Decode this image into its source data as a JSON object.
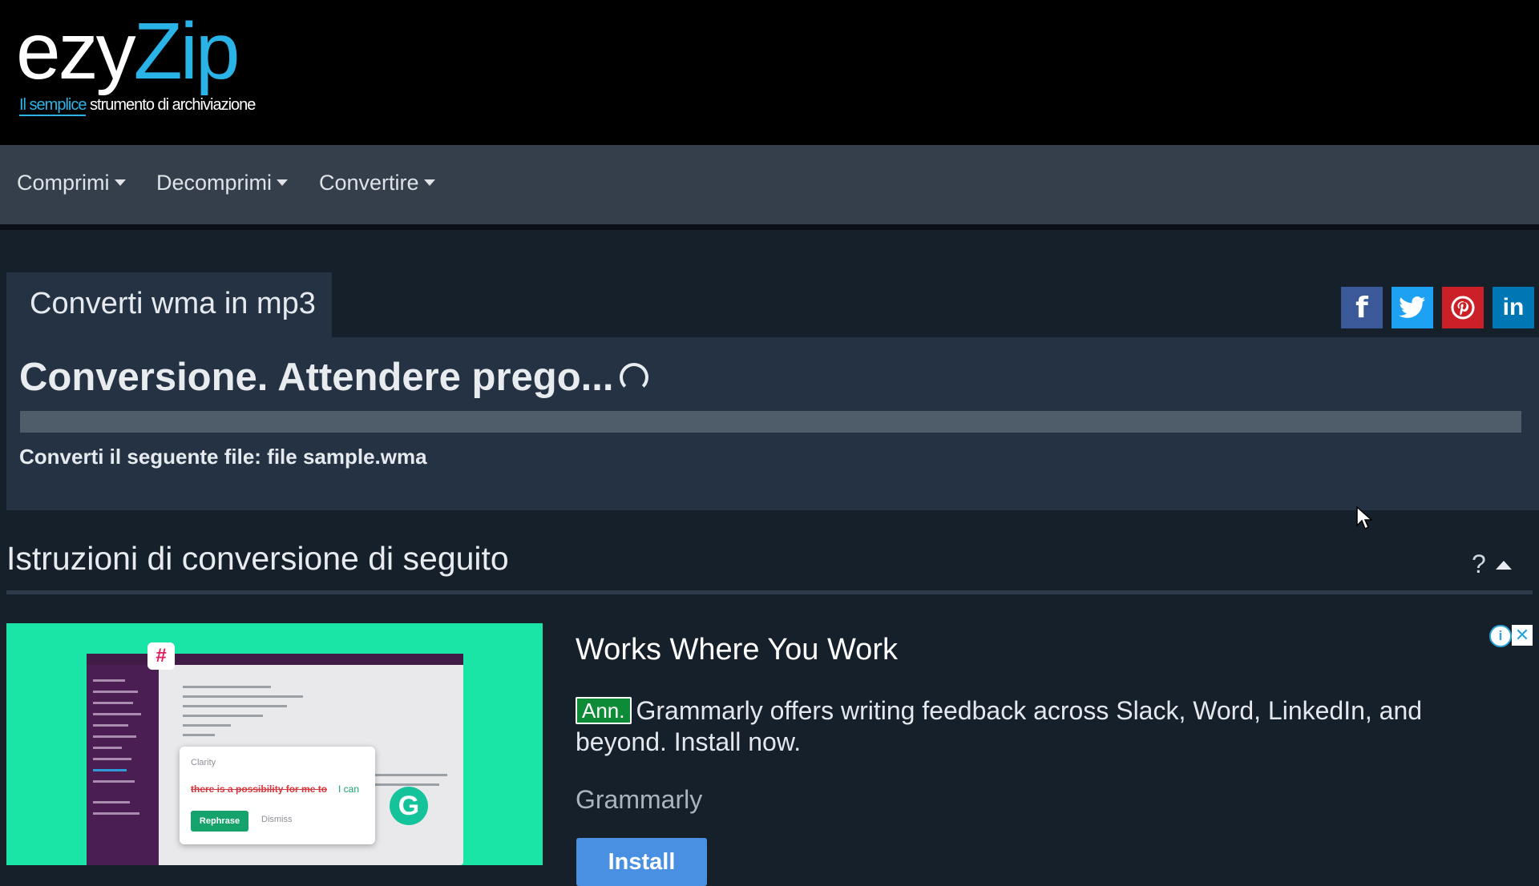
{
  "logo": {
    "brand_part1": "ezy",
    "brand_part2": "Zip",
    "tagline_highlight": "Il semplice",
    "tagline_rest": " strumento di archiviazione"
  },
  "nav": {
    "items": [
      {
        "label": "Comprimi"
      },
      {
        "label": "Decomprimi"
      },
      {
        "label": "Convertire"
      }
    ]
  },
  "converter": {
    "tab_title": "Converti wma in mp3",
    "status": "Conversione. Attendere prego...",
    "progress_fraction": 0,
    "file_line": "Converti il seguente file: file sample.wma"
  },
  "social": {
    "facebook_glyph": "f",
    "linkedin_glyph": "in",
    "icons": [
      "facebook-icon",
      "twitter-icon",
      "pinterest-icon",
      "linkedin-icon"
    ]
  },
  "instructions": {
    "heading": "Istruzioni di conversione di seguito",
    "help": "?"
  },
  "ad": {
    "headline": "Works Where You Work",
    "badge": "Ann.",
    "body": "Grammarly offers writing feedback across Slack, Word, LinkedIn, and beyond. Install now.",
    "advertiser": "Grammarly",
    "install_label": "Install",
    "info_glyph": "i",
    "close_glyph": "✕",
    "image": {
      "clarity_label": "Clarity",
      "strike_text": "there is a possibility for me to",
      "replacement_text": "I can",
      "rephrase_label": "Rephrase",
      "dismiss_label": "Dismiss",
      "g_glyph": "G"
    }
  },
  "colors": {
    "background": "#16202b",
    "card": "#243244",
    "nav": "#343f4b",
    "brand_accent": "#29b3e6",
    "ad_image_bg": "#1be5a6"
  }
}
